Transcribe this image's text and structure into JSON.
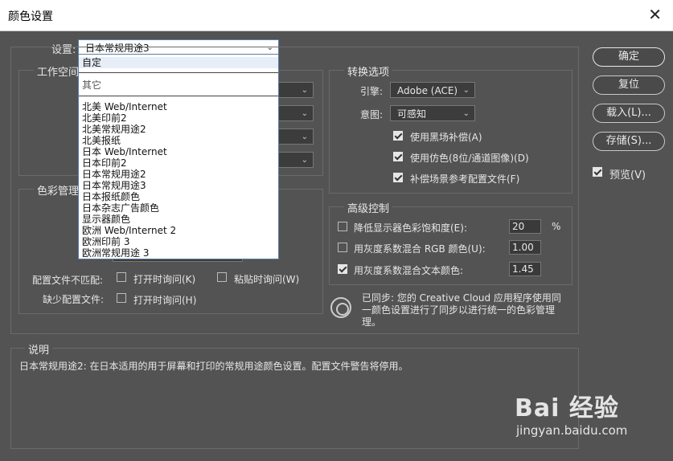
{
  "window": {
    "title": "颜色设置",
    "close": "✕"
  },
  "settings": {
    "label": "设置:",
    "value": "日本常规用途3"
  },
  "dropdown": {
    "top_items": [
      "自定",
      "其它"
    ],
    "items": [
      "北美 Web/Internet",
      "北美印前2",
      "北美常规用途2",
      "北美报纸",
      "日本 Web/Internet",
      "日本印前2",
      "日本常规用途2",
      "日本常规用途3",
      "日本报纸颜色",
      "日本杂志广告颜色",
      "显示器颜色",
      "欧洲 Web/Internet 2",
      "欧洲印前 3",
      "欧洲常规用途 3"
    ]
  },
  "workspace": {
    "legend": "工作空间"
  },
  "color_management": {
    "legend": "色彩管理",
    "profile_mismatch_label": "配置文件不匹配:",
    "open_ask": "打开时询问(K)",
    "paste_ask": "粘贴时询问(W)",
    "missing_label": "缺少配置文件:",
    "missing_open_ask": "打开时询问(H)"
  },
  "conversion": {
    "legend": "转换选项",
    "engine_label": "引擎:",
    "engine_value": "Adobe (ACE)",
    "intent_label": "意图:",
    "intent_value": "可感知",
    "bpc": "使用黑场补偿(A)",
    "dither": "使用仿色(8位/通道图像)(D)",
    "compensate": "补偿场景参考配置文件(F)"
  },
  "advanced": {
    "legend": "高级控制",
    "desaturate": "降低显示器色彩饱和度(E):",
    "desaturate_value": "20",
    "percent": "%",
    "blend_rgb": "用灰度系数混合 RGB 颜色(U):",
    "blend_rgb_value": "1.00",
    "blend_text": "用灰度系数混合文本颜色:",
    "blend_text_value": "1.45"
  },
  "sync": {
    "line1": "已同步: 您的 Creative Cloud 应用程序使用同",
    "line2": "一颜色设置进行了同步以进行统一的色彩管理",
    "line3": "理。"
  },
  "description": {
    "legend": "说明",
    "text": "日本常规用途2: 在日本适用的用于屏幕和打印的常规用途颜色设置。配置文件警告将停用。"
  },
  "buttons": {
    "ok": "确定",
    "reset": "复位",
    "load": "载入(L)...",
    "save": "存储(S)...",
    "preview": "预览(V)"
  },
  "watermark": {
    "brand": "Bai 经验",
    "url": "jingyan.baidu.com"
  }
}
